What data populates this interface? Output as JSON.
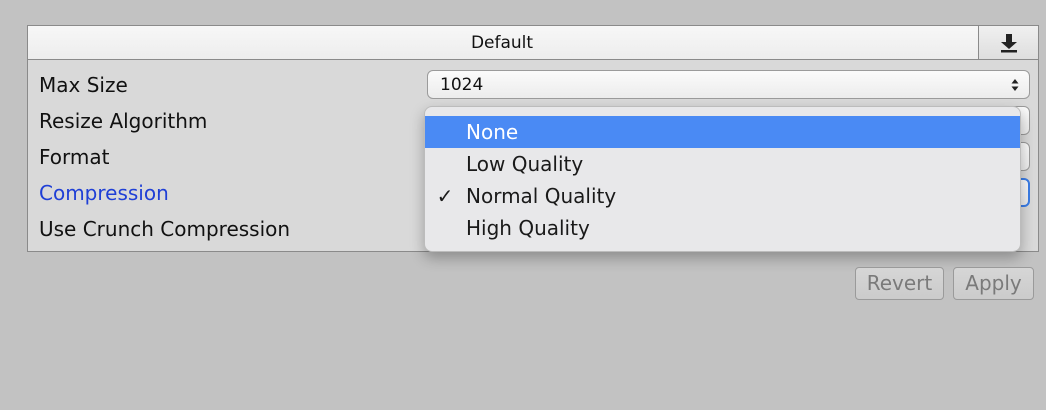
{
  "header": {
    "title": "Default",
    "download_icon": "download-icon"
  },
  "settings": {
    "max_size_label": "Max Size",
    "max_size_value": "1024",
    "resize_algorithm_label": "Resize Algorithm",
    "format_label": "Format",
    "compression_label": "Compression",
    "use_crunch_label": "Use Crunch Compression"
  },
  "dropdown": {
    "checked_item": "Normal Quality",
    "highlighted_item": "None",
    "items": [
      {
        "label": "None",
        "check": ""
      },
      {
        "label": "Low Quality",
        "check": ""
      },
      {
        "label": "Normal Quality",
        "check": "✓"
      },
      {
        "label": "High Quality",
        "check": ""
      }
    ]
  },
  "buttons": {
    "revert": "Revert",
    "apply": "Apply"
  },
  "colors": {
    "highlight": "#4a8af4",
    "label_blue": "#1f3fd6",
    "focus_ring": "#3b7de6"
  }
}
